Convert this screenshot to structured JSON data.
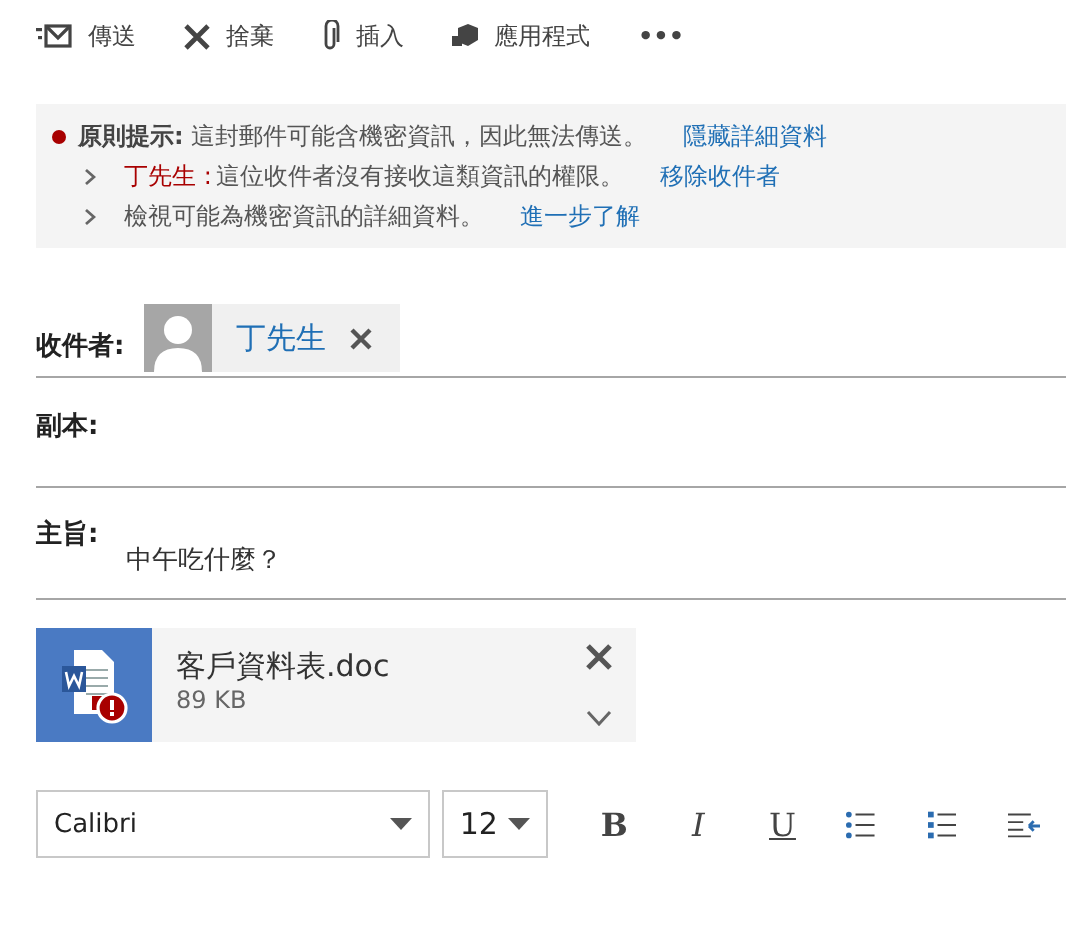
{
  "toolbar": [
    {
      "kind": "send",
      "label": "傳送"
    },
    {
      "kind": "discard",
      "label": "捨棄"
    },
    {
      "kind": "attach",
      "label": "插入"
    },
    {
      "kind": "apps",
      "label": "應用程式"
    },
    {
      "kind": "more",
      "label": "•••"
    }
  ],
  "policy_tip": {
    "title": "原則提示:",
    "message": "這封郵件可能含機密資訊，因此無法傳送。",
    "link": "隱藏詳細資料",
    "details": [
      {
        "name": "丁先生 :",
        "text": "這位收件者沒有接收這類資訊的權限。",
        "link": "移除收件者"
      },
      {
        "text": "檢視可能為機密資訊的詳細資料。",
        "link": "進一步了解"
      }
    ]
  },
  "to": {
    "label": "收件者:",
    "recipients": [
      {
        "name": "丁先生"
      }
    ]
  },
  "cc": {
    "label": "副本:"
  },
  "subject": {
    "label": "主旨:",
    "value": "中午吃什麼？"
  },
  "attachment": {
    "name": "客戶資料表.doc",
    "size": "89 KB",
    "warning": true
  },
  "format_bar": {
    "font": "Calibri",
    "size": "12",
    "buttons": [
      {
        "kind": "bold",
        "label": "B"
      },
      {
        "kind": "italic",
        "label": "I"
      },
      {
        "kind": "underline",
        "label": "U"
      },
      {
        "kind": "bullets"
      },
      {
        "kind": "numbering"
      },
      {
        "kind": "outdent"
      }
    ]
  }
}
